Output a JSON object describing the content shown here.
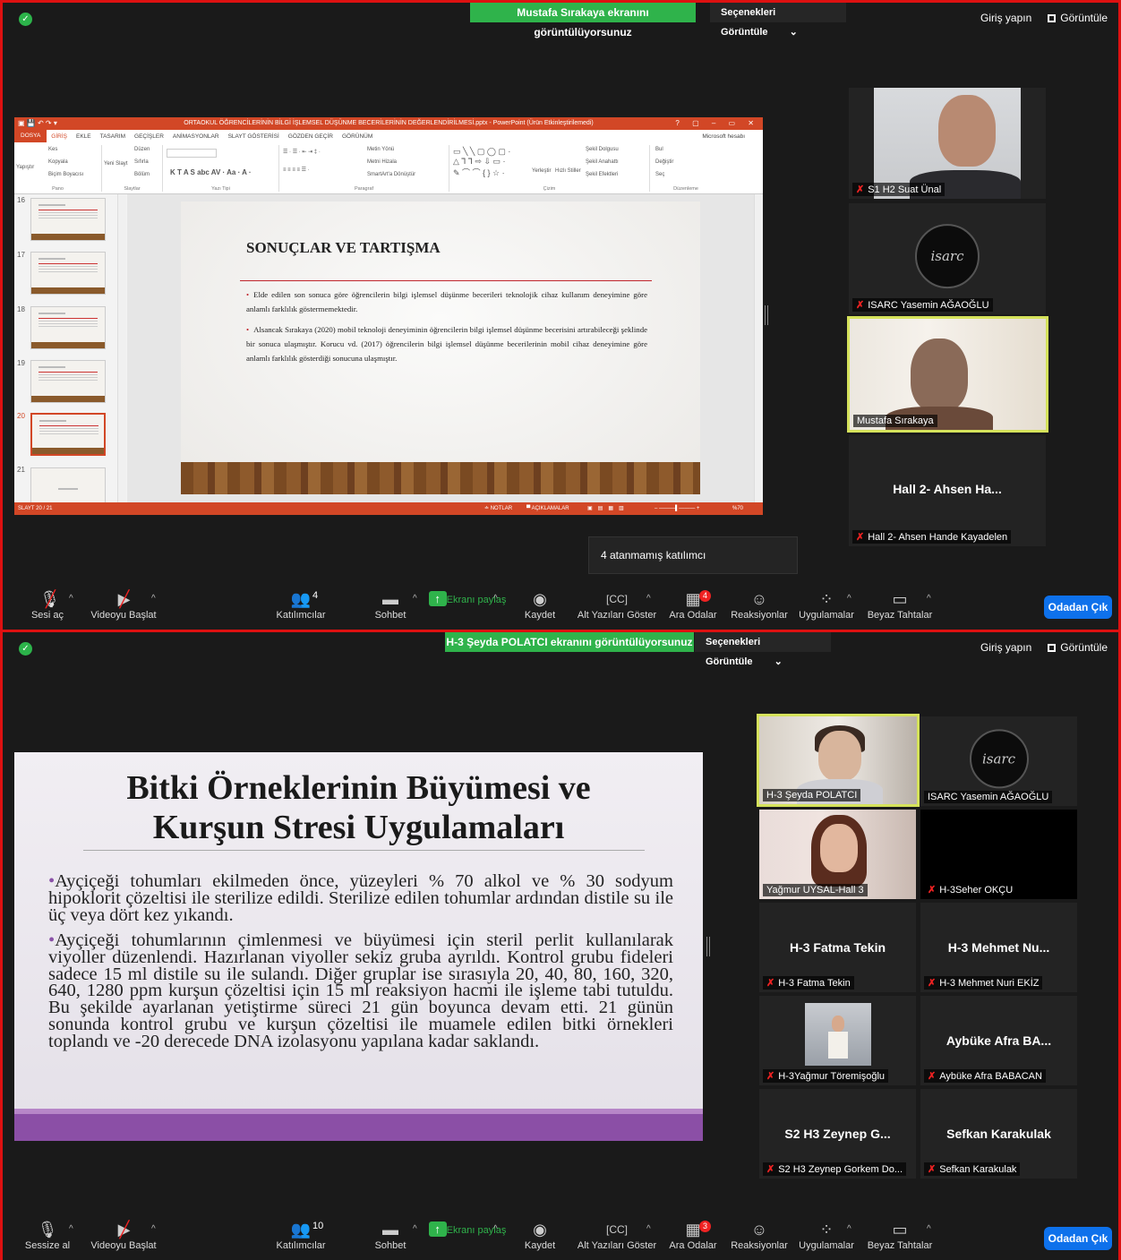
{
  "window1": {
    "banner": "Mustafa Sırakaya ekranını görüntülüyorsunuz",
    "view_options": "Seçenekleri Görüntüle",
    "signin": "Giriş yapın",
    "view": "Görüntüle",
    "tooltip": "4 atanmamış katılımcı",
    "participants_count": "4",
    "breakout_badge": "4",
    "mute_label": "Sesi aç",
    "tiles": [
      {
        "name": "S1 H2 Suat Ünal",
        "muted": true
      },
      {
        "name": "ISARC Yasemin AĞAOĞLU",
        "muted": true
      },
      {
        "name": "Mustafa Sırakaya",
        "muted": false
      },
      {
        "name": "Hall 2- Ahsen Hande Kayadelen",
        "big": "Hall 2- Ahsen Ha...",
        "muted": true
      }
    ]
  },
  "window2": {
    "banner": "H-3 Şeyda POLATCI ekranını görüntülüyorsunuz",
    "view_options": "Seçenekleri Görüntüle",
    "signin": "Giriş yapın",
    "view": "Görüntüle",
    "participants_count": "10",
    "breakout_badge": "3",
    "mute_label": "Sessize al",
    "tiles": [
      {
        "name": "H-3 Şeyda POLATCI",
        "muted": false
      },
      {
        "name": "ISARC Yasemin AĞAOĞLU",
        "muted": false
      },
      {
        "name": "Yağmur UYSAL-Hall 3",
        "muted": false
      },
      {
        "name": "H-3Seher OKÇU",
        "muted": true
      },
      {
        "name": "H-3 Fatma Tekin",
        "big": "H-3 Fatma Tekin",
        "muted": true
      },
      {
        "name": "H-3 Mehmet Nuri EKİZ",
        "big": "H-3 Mehmet Nu...",
        "muted": true
      },
      {
        "name": "H-3Yağmur Töremişoğlu",
        "muted": true
      },
      {
        "name": "Aybüke Afra BABACAN",
        "big": "Aybüke Afra BA...",
        "muted": true
      },
      {
        "name": "S2 H3 Zeynep Gorkem Do...",
        "big": "S2 H3 Zeynep G...",
        "muted": true
      },
      {
        "name": "Sefkan Karakulak",
        "big": "Sefkan Karakulak",
        "muted": true
      }
    ]
  },
  "toolbar": {
    "video": "Videoyu Başlat",
    "participants": "Katılımcılar",
    "chat": "Sohbet",
    "share": "Ekranı paylaş",
    "record": "Kaydet",
    "cc": "Alt Yazıları Göster",
    "breakout": "Ara Odalar",
    "reactions": "Reaksiyonlar",
    "apps": "Uygulamalar",
    "whiteboard": "Beyaz Tahtalar",
    "leave": "Odadan Çık"
  },
  "ppt": {
    "window_title": "ORTAOKUL ÖĞRENCİLERİNİN BİLGİ İŞLEMSEL DÜŞÜNME BECERİLERİNİN DEĞERLENDİRİLMESİ.pptx - PowerPoint (Ürün Etkinleştirilemedi)",
    "tabs": [
      "GİRİŞ",
      "EKLE",
      "TASARIM",
      "GEÇİŞLER",
      "ANİMASYONLAR",
      "SLAYT GÖSTERİSİ",
      "GÖZDEN GEÇİR",
      "GÖRÜNÜM"
    ],
    "file_tab": "DOSYA",
    "account": "Microsoft hesabı",
    "groups": [
      "Pano",
      "Slaytlar",
      "Yazı Tipi",
      "Paragraf",
      "Çizim",
      "Düzenleme"
    ],
    "ribbon": {
      "cut": "Kes",
      "copy": "Kopyala",
      "painter": "Biçim Boyacısı",
      "paste": "Yapıştır",
      "new_slide": "Yeni Slayt",
      "layout": "Düzen",
      "reset": "Sıfırla",
      "section": "Bölüm",
      "text_dir": "Metin Yönü",
      "align_text": "Metni Hizala",
      "smartart": "SmartArt'a Dönüştür",
      "arrange": "Yerleştir",
      "quick_styles": "Hızlı Stiller",
      "fill": "Şekil Dolgusu",
      "outline": "Şekil Anahattı",
      "effects": "Şekil Efektleri",
      "find": "Bul",
      "replace": "Değiştir",
      "select": "Seç"
    },
    "thumb_numbers": [
      "16",
      "17",
      "18",
      "19",
      "20",
      "21"
    ],
    "status_left": "SLAYT 20 / 21",
    "notes": "NOTLAR",
    "comments": "AÇIKLAMALAR",
    "zoom": "%70",
    "slide_title": "SONUÇLAR VE TARTIŞMA",
    "bullets": [
      "Elde edilen son sonuca göre öğrencilerin bilgi işlemsel düşünme becerileri teknolojik cihaz kullanım deneyimine göre anlamlı farklılık göstermemektedir.",
      "Alsancak Sırakaya (2020) mobil teknoloji deneyiminin öğrencilerin bilgi işlemsel düşünme becerisini artırabileceği şeklinde bir sonuca ulaşmıştır. Korucu vd. (2017) öğrencilerin bilgi işlemsel düşünme becerilerinin mobil cihaz deneyimine göre anlamlı farklılık gösterdiği sonucuna ulaşmıştır."
    ]
  },
  "slide2": {
    "title_line1": "Bitki Örneklerinin Büyümesi ve",
    "title_line2": "Kurşun Stresi Uygulamaları",
    "para1": "Ayçiçeği tohumları ekilmeden önce, yüzeyleri % 70 alkol ve % 30 sodyum hipoklorit çözeltisi ile sterilize edildi. Sterilize edilen tohumlar ardından distile su ile üç veya dört kez yıkandı.",
    "para2": "Ayçiçeği tohumlarının çimlenmesi ve büyümesi için steril perlit kullanılarak viyoller düzenlendi. Hazırlanan viyoller sekiz gruba ayrıldı. Kontrol grubu fideleri sadece 15 ml distile su ile sulandı. Diğer gruplar ise sırasıyla 20, 40, 80, 160, 320, 640, 1280 ppm kurşun çözeltisi için 15 ml reaksiyon hacmi ile işleme tabi tutuldu. Bu şekilde ayarlanan yetiştirme süreci 21 gün boyunca devam etti. 21 günün sonunda kontrol grubu ve kurşun çözeltisi ile muamele edilen bitki örnekleri toplandı ve -20 derecede DNA izolasyonu yapılana kadar saklandı."
  },
  "logo_text": "isarc",
  "colors": {
    "accent_green": "#2fb34b",
    "ppt_red": "#d24726",
    "active_border": "#d5e25b",
    "leave_blue": "#0e71eb"
  }
}
